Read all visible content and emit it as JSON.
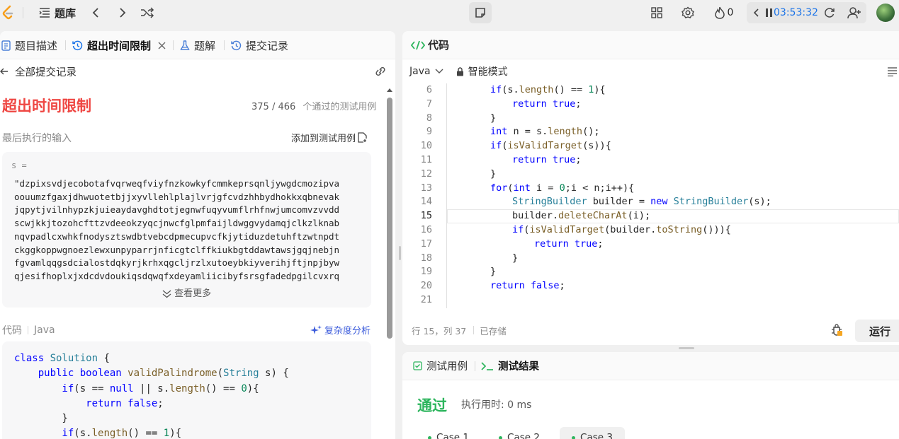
{
  "topnav": {
    "title": "题库",
    "coins": "0",
    "timer": "03:53:32"
  },
  "tabs": [
    {
      "label": "题目描述"
    },
    {
      "label": "超出时间限制"
    },
    {
      "label": "题解"
    },
    {
      "label": "提交记录"
    }
  ],
  "subbar": {
    "back_label": "全部提交记录"
  },
  "result": {
    "status": "超出时间限制",
    "passed": "375 / 466",
    "passed_suffix": "个通过的测试用例",
    "last_input_label": "最后执行的输入",
    "add_test_label": "添加到测试用例",
    "input_var": "s =",
    "input_lines": [
      "\"dzpixsvdjecobotafvqrweqfviyfnzkowkyfcmmkeprsqnljywgdcmozipva",
      "oouumzfgaxjdhwuotetbjjxyvllehlplajlvrjgfcvdzhhbydhokkxqbnevak",
      "jqpytjvilnhypzkjuieaydavghdtotjegnwfuqyvumflrhfnwjumcomvzvvdd",
      "scwjkkjtozohcfttzvdeeokzyqcjnwcfglpmfaijldwggvydamqjclkzlknab",
      "nqvpadlcxwhkfnodysztswdbtvebcdpmecupvcfkjytiduzdetuhftzwtnpdt",
      "ckggkoppwgnoezlewxunpyparrjnficgtclffkiukbgtddawtawsjgqjnebjn",
      "fgvamlqqgsdcialostdqkyrjkrhxqgcljrzlxutoeybkiyverihjftjnpjbyw",
      "qjesifhoplxjxdcdvdoukiqsdqwqfxdeyamliicibyfsrsgfadedpgilcvxrq"
    ],
    "see_more": "查看更多",
    "code_label": "代码",
    "code_lang": "Java",
    "complexity_label": "复杂度分析"
  },
  "submitted_code": [
    [
      {
        "t": "class ",
        "c": "kw"
      },
      {
        "t": "Solution",
        "c": "ty"
      },
      {
        "t": " {",
        "c": ""
      }
    ],
    [
      {
        "t": "    public boolean ",
        "c": "kw"
      },
      {
        "t": "validPalindrome",
        "c": "fn"
      },
      {
        "t": "(",
        "c": ""
      },
      {
        "t": "String",
        "c": "ty"
      },
      {
        "t": " s) {",
        "c": ""
      }
    ],
    [
      {
        "t": "        if",
        "c": "kw"
      },
      {
        "t": "(s == ",
        "c": ""
      },
      {
        "t": "null",
        "c": "kw"
      },
      {
        "t": " || s.",
        "c": ""
      },
      {
        "t": "length",
        "c": "fn"
      },
      {
        "t": "() == ",
        "c": ""
      },
      {
        "t": "0",
        "c": "num"
      },
      {
        "t": "){",
        "c": ""
      }
    ],
    [
      {
        "t": "            return false",
        "c": "kw"
      },
      {
        "t": ";",
        "c": ""
      }
    ],
    [
      {
        "t": "        }",
        "c": ""
      }
    ],
    [
      {
        "t": "        if",
        "c": "kw"
      },
      {
        "t": "(s.",
        "c": ""
      },
      {
        "t": "length",
        "c": "fn"
      },
      {
        "t": "() == ",
        "c": ""
      },
      {
        "t": "1",
        "c": "num"
      },
      {
        "t": "){",
        "c": ""
      }
    ]
  ],
  "editor": {
    "title": "代码",
    "language": "Java",
    "mode": "智能模式",
    "cursor": "行 15，列 37",
    "saved": "已存储",
    "run_label": "运行",
    "current_line": 15,
    "lines": [
      {
        "n": 6,
        "parts": [
          {
            "t": "if",
            "c": "kw"
          },
          {
            "t": "(s.",
            "c": ""
          },
          {
            "t": "length",
            "c": "fn"
          },
          {
            "t": "() == ",
            "c": ""
          },
          {
            "t": "1",
            "c": "num"
          },
          {
            "t": "){",
            "c": ""
          }
        ],
        "indent": 0
      },
      {
        "n": 7,
        "parts": [
          {
            "t": "return true",
            "c": "kw"
          },
          {
            "t": ";",
            "c": ""
          }
        ],
        "indent": 1
      },
      {
        "n": 8,
        "parts": [
          {
            "t": "}",
            "c": ""
          }
        ],
        "indent": 0
      },
      {
        "n": 9,
        "parts": [
          {
            "t": "int",
            "c": "kw"
          },
          {
            "t": " n = s.",
            "c": ""
          },
          {
            "t": "length",
            "c": "fn"
          },
          {
            "t": "();",
            "c": ""
          }
        ],
        "indent": 0
      },
      {
        "n": 10,
        "parts": [
          {
            "t": "if",
            "c": "kw"
          },
          {
            "t": "(",
            "c": ""
          },
          {
            "t": "isValidTarget",
            "c": "fn"
          },
          {
            "t": "(s)){",
            "c": ""
          }
        ],
        "indent": 0
      },
      {
        "n": 11,
        "parts": [
          {
            "t": "return true",
            "c": "kw"
          },
          {
            "t": ";",
            "c": ""
          }
        ],
        "indent": 1
      },
      {
        "n": 12,
        "parts": [
          {
            "t": "}",
            "c": ""
          }
        ],
        "indent": 0
      },
      {
        "n": 13,
        "parts": [
          {
            "t": "for",
            "c": "kw"
          },
          {
            "t": "(",
            "c": ""
          },
          {
            "t": "int",
            "c": "kw"
          },
          {
            "t": " i = ",
            "c": ""
          },
          {
            "t": "0",
            "c": "num"
          },
          {
            "t": ";i < n;i++){",
            "c": ""
          }
        ],
        "indent": 0
      },
      {
        "n": 14,
        "parts": [
          {
            "t": "StringBuilder",
            "c": "ty"
          },
          {
            "t": " builder = ",
            "c": ""
          },
          {
            "t": "new ",
            "c": "kw"
          },
          {
            "t": "StringBuilder",
            "c": "ty"
          },
          {
            "t": "(s);",
            "c": ""
          }
        ],
        "indent": 1
      },
      {
        "n": 15,
        "parts": [
          {
            "t": "builder.",
            "c": ""
          },
          {
            "t": "deleteCharAt",
            "c": "fn"
          },
          {
            "t": "(i);",
            "c": ""
          }
        ],
        "indent": 1
      },
      {
        "n": 16,
        "parts": [
          {
            "t": "if",
            "c": "kw"
          },
          {
            "t": "(",
            "c": ""
          },
          {
            "t": "isValidTarget",
            "c": "fn"
          },
          {
            "t": "(builder.",
            "c": ""
          },
          {
            "t": "toString",
            "c": "fn"
          },
          {
            "t": "())){",
            "c": ""
          }
        ],
        "indent": 1
      },
      {
        "n": 17,
        "parts": [
          {
            "t": "return true",
            "c": "kw"
          },
          {
            "t": ";",
            "c": ""
          }
        ],
        "indent": 2
      },
      {
        "n": 18,
        "parts": [
          {
            "t": "}",
            "c": ""
          }
        ],
        "indent": 1
      },
      {
        "n": 19,
        "parts": [
          {
            "t": "}",
            "c": ""
          }
        ],
        "indent": 0
      },
      {
        "n": 20,
        "parts": [
          {
            "t": "return false",
            "c": "kw"
          },
          {
            "t": ";",
            "c": ""
          }
        ],
        "indent": 0
      },
      {
        "n": 21,
        "parts": [],
        "indent": 0
      }
    ]
  },
  "testpanel": {
    "tab_cases": "测试用例",
    "tab_results": "测试结果",
    "status": "通过",
    "runtime": "执行用时: 0 ms",
    "cases": [
      "Case 1",
      "Case 2",
      "Case 3"
    ]
  },
  "colors": {
    "error": "#ef4743",
    "success": "#2db55d",
    "accent": "#1a73e8"
  },
  "icons": [
    "leetcode-logo-icon",
    "problem-list-icon",
    "prev-icon",
    "next-icon",
    "shuffle-icon",
    "note-icon",
    "layout-icon",
    "settings-icon",
    "fire-icon",
    "pause-icon",
    "reset-icon",
    "add-user-icon"
  ]
}
